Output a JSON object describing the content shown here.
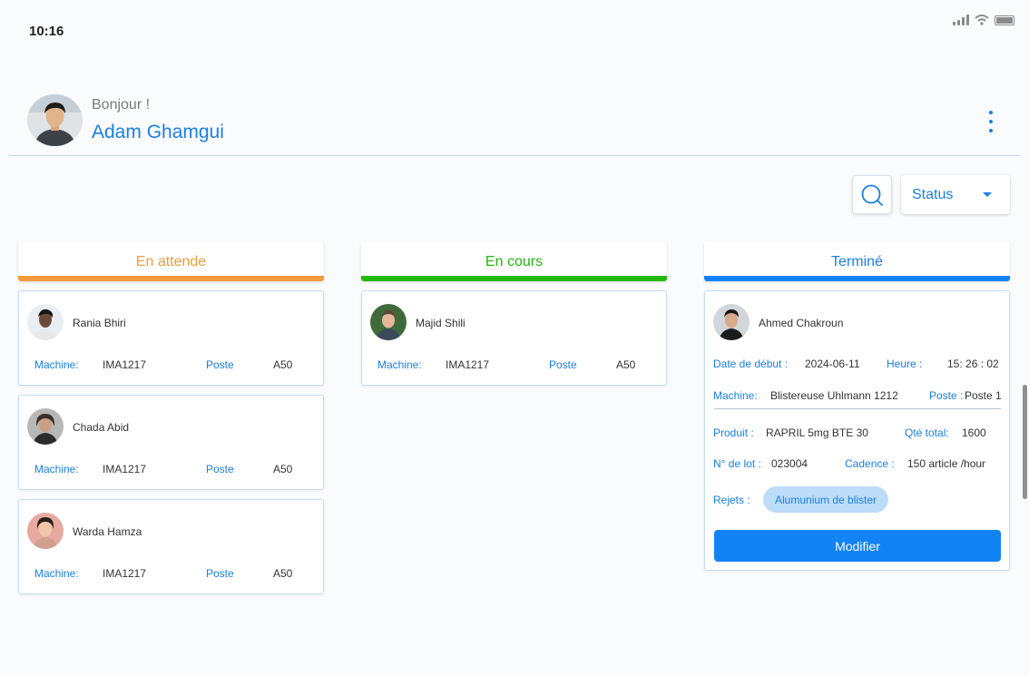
{
  "status_bar": {
    "time": "10:16"
  },
  "header": {
    "greeting": "Bonjour !",
    "user_name": "Adam Ghamgui"
  },
  "toolbar": {
    "status_label": "Status"
  },
  "colors": {
    "accent": "#1a7fe6",
    "waiting": "#f39a3c",
    "in_progress": "#22b80c",
    "done": "#1283f5"
  },
  "columns": [
    {
      "title": "En attende",
      "cards": [
        {
          "name": "Rania Bhiri",
          "machine_label": "Machine:",
          "machine": "IMA1217",
          "poste_label": "Poste",
          "poste": "A50"
        },
        {
          "name": "Chada Abid",
          "machine_label": "Machine:",
          "machine": "IMA1217",
          "poste_label": "Poste",
          "poste": "A50"
        },
        {
          "name": "Warda Hamza",
          "machine_label": "Machine:",
          "machine": "IMA1217",
          "poste_label": "Poste",
          "poste": "A50"
        }
      ]
    },
    {
      "title": "En cours",
      "cards": [
        {
          "name": "Majid Shili",
          "machine_label": "Machine:",
          "machine": "IMA1217",
          "poste_label": "Poste",
          "poste": "A50"
        }
      ]
    },
    {
      "title": "Terminé",
      "card": {
        "name": "Ahmed Chakroun",
        "date_label": "Date de début :",
        "date": "2024-06-11",
        "heure_label": "Heure :",
        "heure": "15: 26 : 02",
        "machine_label": "Machine:",
        "machine": "Blistereuse Uhlmann 1212",
        "poste_label": "Poste :",
        "poste": "Poste 1",
        "produit_label": "Produit :",
        "produit": "RAPRIL 5mg BTE 30",
        "qte_label": "Qté total:",
        "qte": "1600",
        "lot_label": "N° de lot :",
        "lot": "023004",
        "cadence_label": "Cadence :",
        "cadence": "150 article /hour",
        "rejets_label": "Rejets :",
        "rejet_chip": "Alumunium de blister",
        "button_label": "Modifier"
      }
    }
  ]
}
